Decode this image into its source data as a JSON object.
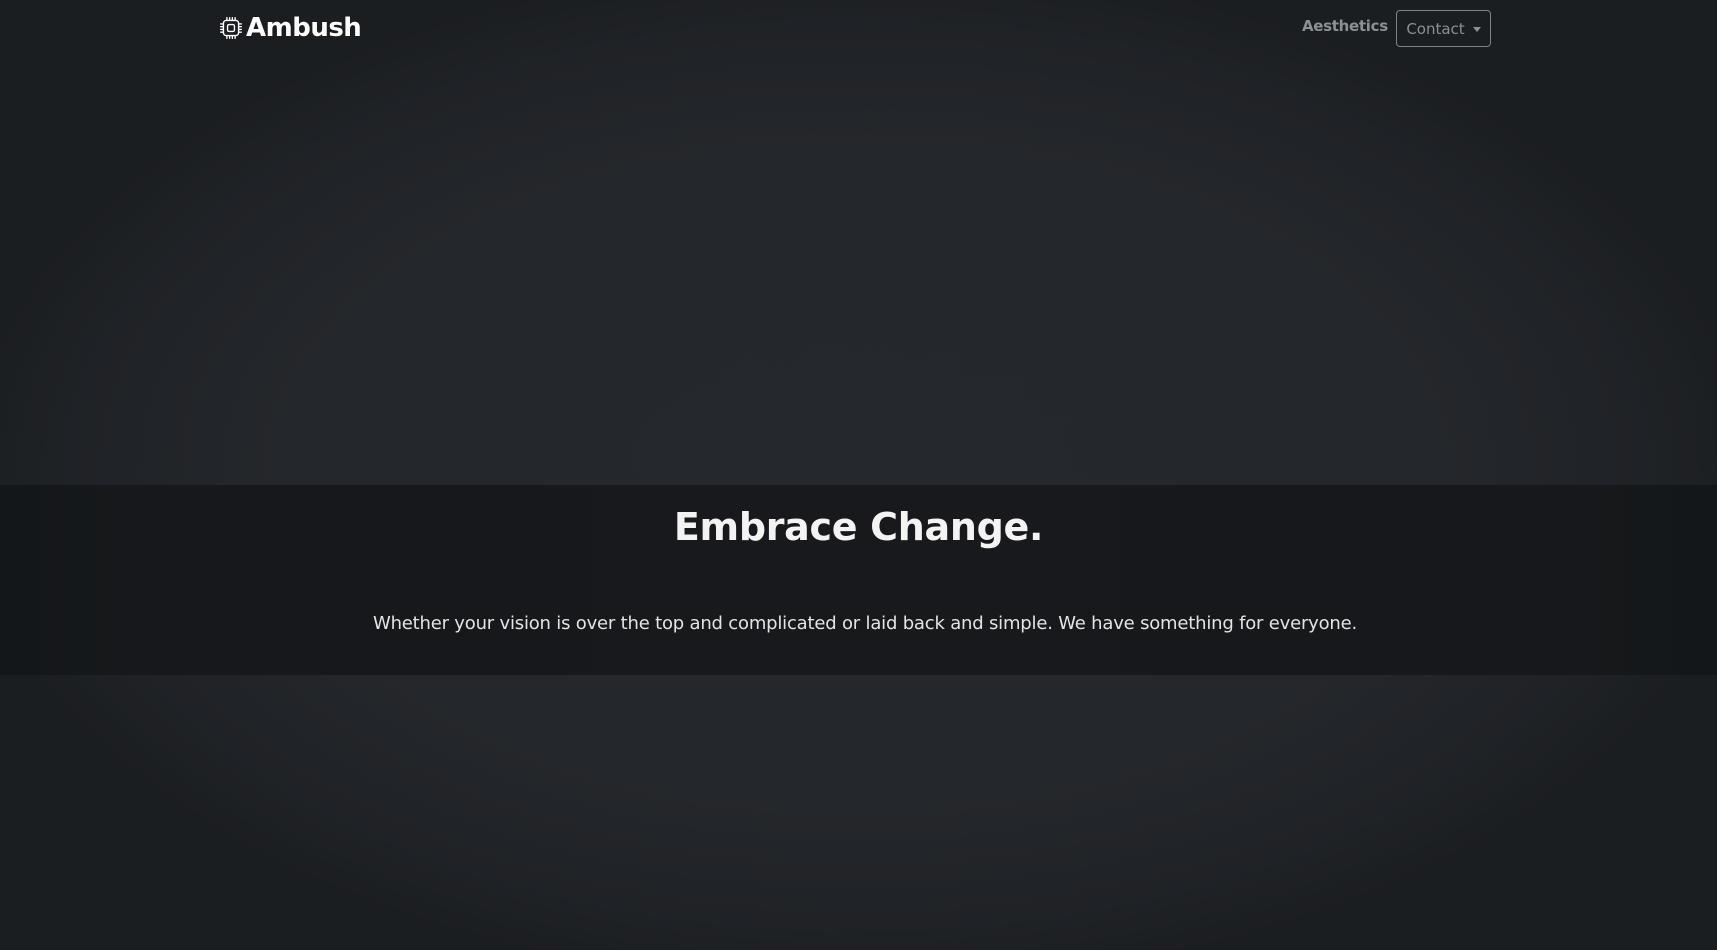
{
  "navbar": {
    "brand": {
      "icon": "cpu-chip-icon",
      "label": "Ambush"
    },
    "links": [
      {
        "label": "Aesthetics"
      }
    ],
    "dropdown": {
      "label": "Contact"
    }
  },
  "hero": {
    "headline": "Embrace Change.",
    "lead": "Whether your vision is over the top and complicated or laid back and simple. We have something for everyone."
  },
  "colors": {
    "background": "#24272b",
    "band": "#17191c",
    "nav_muted": "#8c9095",
    "text": "#ffffff"
  }
}
